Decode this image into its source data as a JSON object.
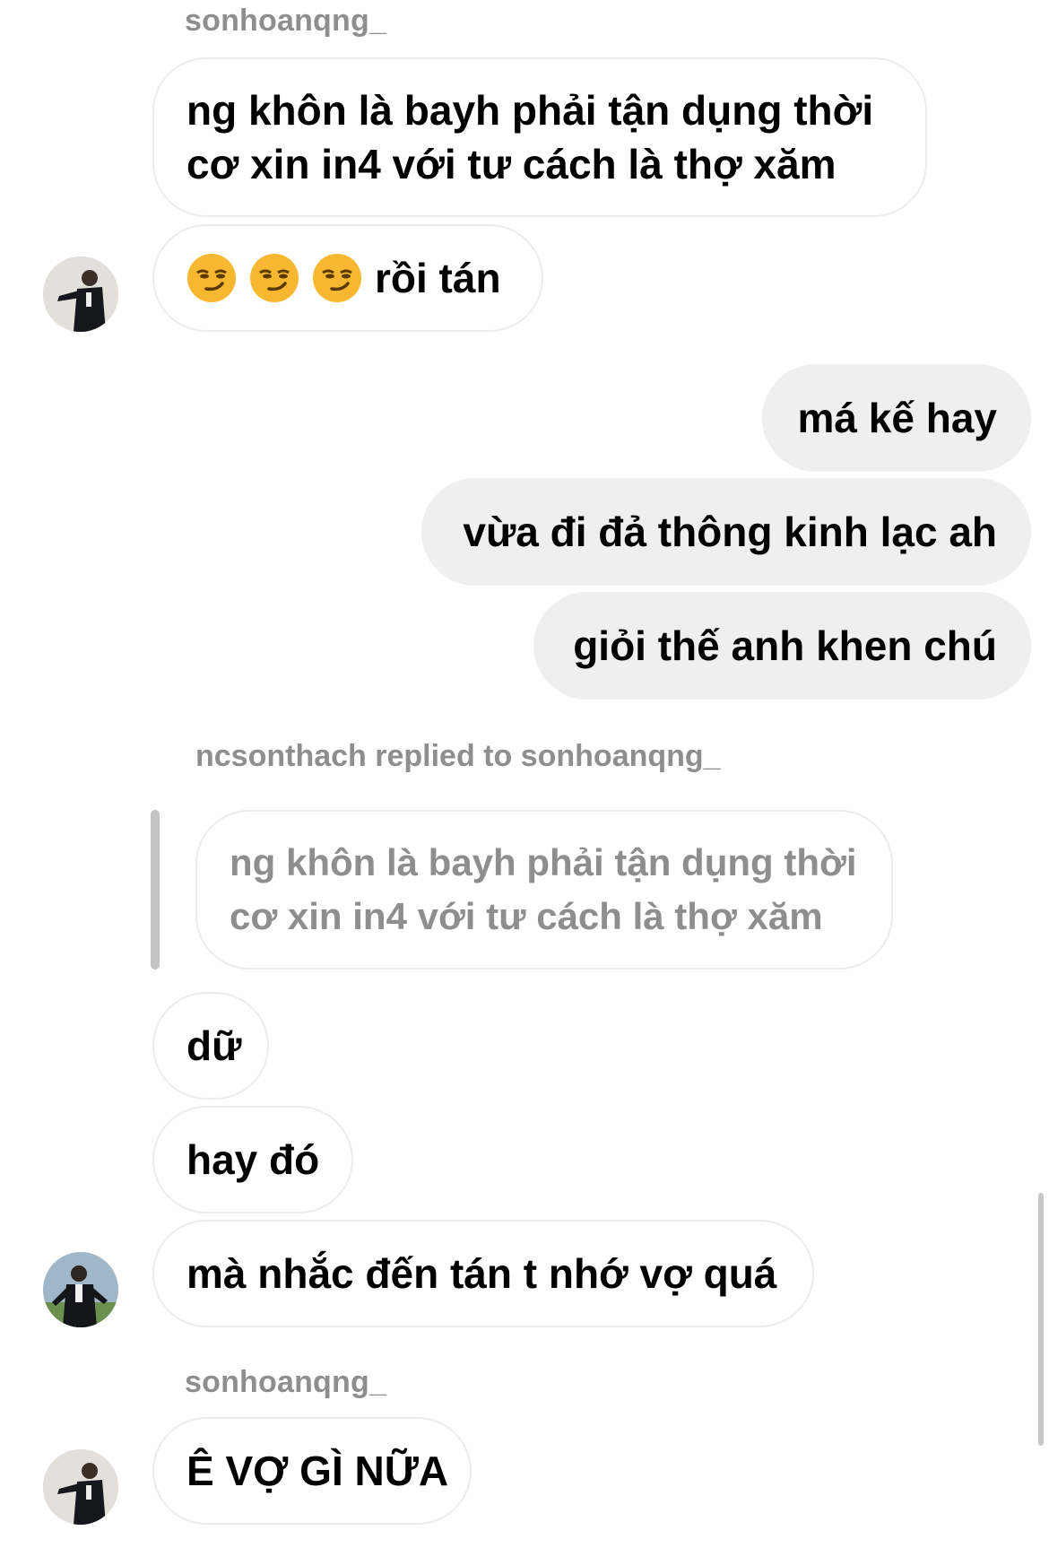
{
  "messages": {
    "top_sender": "sonhoanqng_",
    "m1_line1": "ng khôn là bayh phải tận dụng thời",
    "m1_line2": "cơ xin in4 với tư cách là thợ xăm",
    "m2_emojis": [
      "smirking-face",
      "smirking-face",
      "smirking-face"
    ],
    "m2_text": "rồi tán",
    "out1": "má kế hay",
    "out2": "vừa đi đả thông kinh lạc ah",
    "out3": "giỏi thế anh khen chú",
    "reply_label": "ncsonthach replied to sonhoanqng_",
    "quoted_line1": "ng khôn là bayh phải tận dụng thời",
    "quoted_line2": "cơ xin in4 với tư cách là thợ xăm",
    "m3": "dữ",
    "m4": "hay đó",
    "m5": "mà nhắc đến tán t nhớ vợ quá",
    "bottom_sender": "sonhoanqng_",
    "m6": "Ê VỢ GÌ NỮA"
  },
  "colors": {
    "incoming_border": "#ececec",
    "outgoing_bg": "#efefef",
    "meta_text": "#8e8e8e"
  }
}
